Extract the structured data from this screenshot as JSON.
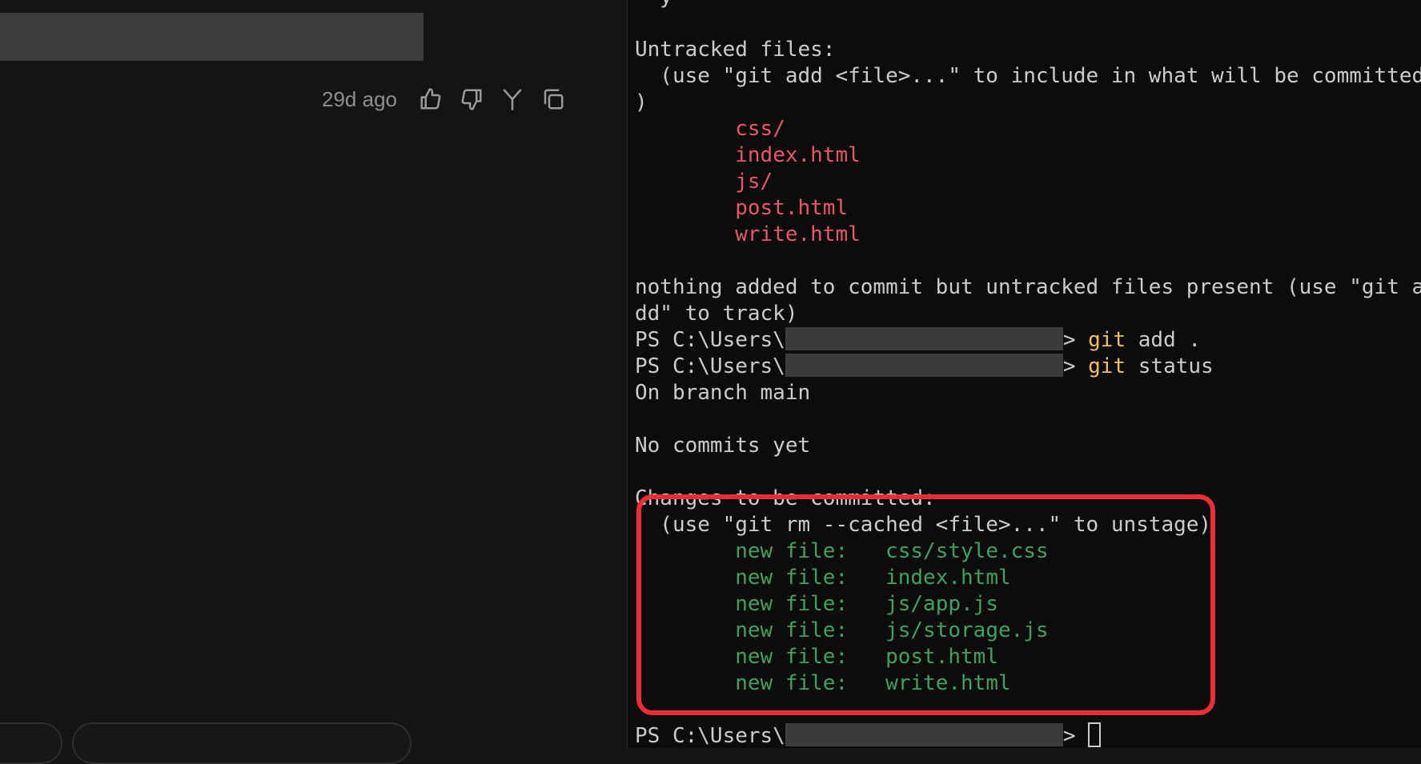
{
  "chat": {
    "timestamp": "29d ago",
    "actions": [
      {
        "icon": "thumbs-up-icon"
      },
      {
        "icon": "thumbs-down-icon"
      },
      {
        "icon": "branch-icon"
      },
      {
        "icon": "copy-icon"
      }
    ]
  },
  "terminal": {
    "prompt_prefix": "PS C:\\Users\\",
    "prompt_suffix": ">",
    "colors": {
      "text": "#cccccc",
      "untracked": "#e9566a",
      "staged": "#3fa15d",
      "command": "#f2be6a",
      "highlight": "#ee2c35"
    },
    "header_partial": "  y",
    "untracked_heading": "Untracked files:",
    "untracked_hint_1": "  (use \"git add <file>...\" to include in what will be committed",
    "untracked_hint_2": ")",
    "untracked_files": [
      "css/",
      "index.html",
      "js/",
      "post.html",
      "write.html"
    ],
    "nothing_added_1": "nothing added to commit but untracked files present (use \"git a",
    "nothing_added_2": "dd\" to track)",
    "commands": [
      {
        "cmd": "git",
        "args": " add ."
      },
      {
        "cmd": "git",
        "args": " status"
      }
    ],
    "on_branch": "On branch main",
    "no_commits": "No commits yet",
    "changes_heading": "Changes to be committed:",
    "unstage_hint": "  (use \"git rm --cached <file>...\" to unstage)",
    "new_file_label": "new file:",
    "staged_files": [
      "css/style.css",
      "index.html",
      "js/app.js",
      "js/storage.js",
      "post.html",
      "write.html"
    ]
  }
}
